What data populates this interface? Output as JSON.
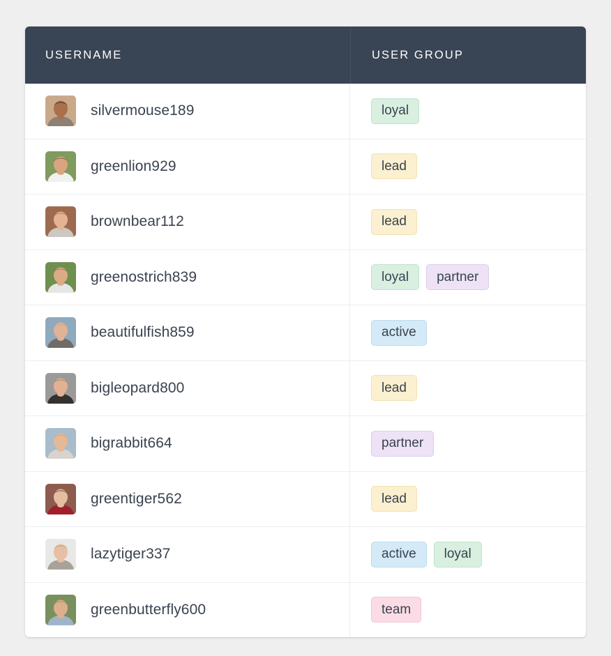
{
  "table": {
    "columns": [
      {
        "key": "username",
        "label": "USERNAME"
      },
      {
        "key": "user_group",
        "label": "USER GROUP"
      }
    ],
    "rows": [
      {
        "username": "silvermouse189",
        "groups": [
          "loyal"
        ],
        "avatar": "photo-man-smiling-tan"
      },
      {
        "username": "greenlion929",
        "groups": [
          "lead"
        ],
        "avatar": "photo-man-sunglasses-beard"
      },
      {
        "username": "brownbear112",
        "groups": [
          "lead"
        ],
        "avatar": "photo-woman-auburn-hair"
      },
      {
        "username": "greenostrich839",
        "groups": [
          "loyal",
          "partner"
        ],
        "avatar": "photo-man-outdoors-green"
      },
      {
        "username": "beautifulfish859",
        "groups": [
          "active"
        ],
        "avatar": "photo-woman-glasses-curly"
      },
      {
        "username": "bigleopard800",
        "groups": [
          "lead"
        ],
        "avatar": "photo-woman-gray-background"
      },
      {
        "username": "bigrabbit664",
        "groups": [
          "partner"
        ],
        "avatar": "photo-woman-blonde-smiling"
      },
      {
        "username": "greentiger562",
        "groups": [
          "lead"
        ],
        "avatar": "photo-woman-red-top-brick"
      },
      {
        "username": "lazytiger337",
        "groups": [
          "active",
          "loyal"
        ],
        "avatar": "photo-woman-glasses-light"
      },
      {
        "username": "greenbutterfly600",
        "groups": [
          "team"
        ],
        "avatar": "photo-man-glasses-plaid"
      }
    ]
  },
  "badge_styles": {
    "loyal": {
      "background": "#d9f0e1",
      "border": "#bfe2cd"
    },
    "lead": {
      "background": "#fbf0cf",
      "border": "#f2e2b0"
    },
    "partner": {
      "background": "#eee2f7",
      "border": "#dccdea"
    },
    "active": {
      "background": "#d4eaf7",
      "border": "#bcdcef"
    },
    "team": {
      "background": "#fbdce5",
      "border": "#f4c5d3"
    }
  },
  "theme": {
    "page_background": "#efefef",
    "card_background": "#ffffff",
    "header_background": "#394454",
    "header_text": "#ffffff",
    "body_text": "#3a4350",
    "divider": "#eceef0"
  },
  "avatar_palettes": {
    "photo-man-smiling-tan": {
      "bg": "#c9a98a",
      "skin": "#a9714b",
      "hair": "#2e2018",
      "cloth": "#8d8173"
    },
    "photo-man-sunglasses-beard": {
      "bg": "#7f9b5e",
      "skin": "#d8a57e",
      "hair": "#6a4a32",
      "cloth": "#f1f1ef"
    },
    "photo-woman-auburn-hair": {
      "bg": "#9d6a4f",
      "skin": "#e3b394",
      "hair": "#a4663a",
      "cloth": "#cdc7c1"
    },
    "photo-man-outdoors-green": {
      "bg": "#6f8f4e",
      "skin": "#dcab85",
      "hair": "#8a6a45",
      "cloth": "#e6e6e4"
    },
    "photo-woman-glasses-curly": {
      "bg": "#8fa9bd",
      "skin": "#e0b396",
      "hair": "#caa377",
      "cloth": "#6f6b68"
    },
    "photo-woman-gray-background": {
      "bg": "#9a9a99",
      "skin": "#e2b193",
      "hair": "#9a7a52",
      "cloth": "#34312f"
    },
    "photo-woman-blonde-smiling": {
      "bg": "#a8bccb",
      "skin": "#e5b897",
      "hair": "#c9a067",
      "cloth": "#d8d3cd"
    },
    "photo-woman-red-top-brick": {
      "bg": "#8d5c4e",
      "skin": "#e6bda0",
      "hair": "#4a3527",
      "cloth": "#a01f2c"
    },
    "photo-woman-glasses-light": {
      "bg": "#e8e8e6",
      "skin": "#e7c0a3",
      "hair": "#b5945f",
      "cloth": "#a8a29b"
    },
    "photo-man-glasses-plaid": {
      "bg": "#7a8f5e",
      "skin": "#dcb08c",
      "hair": "#8d7c63",
      "cloth": "#9fb4c9"
    }
  }
}
